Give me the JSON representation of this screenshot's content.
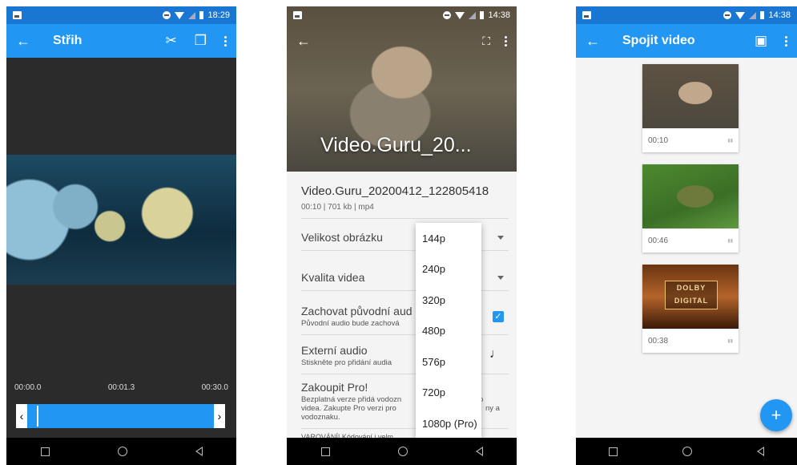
{
  "screen1": {
    "status_time": "18:29",
    "title": "Střih",
    "timeline": {
      "start": "00:00.0",
      "current": "00:01.3",
      "end": "00:30.0"
    },
    "handle_left": "‹",
    "handle_right": "›"
  },
  "screen2": {
    "status_time": "14:38",
    "video_overlay_title": "Video.Guru_20...",
    "file_name": "Video.Guru_20200412_122805418",
    "file_meta": "00:10 | 701 kb | mp4",
    "rows": {
      "image_size": "Velikost obrázku",
      "video_quality": "Kvalita videa",
      "keep_audio": "Zachovat původní aud",
      "keep_audio_sub": "Původní audio bude zachová",
      "external_audio": "Externí audio",
      "external_audio_sub": "Stiskněte pro přidání audia",
      "buy_pro": "Zakoupit Pro!",
      "buy_pro_sub1": "Bezplatná verze přidá vodozn",
      "buy_pro_sub1_tail": "o",
      "buy_pro_sub2": "videa. Zakupte Pro verzi pro",
      "buy_pro_sub2_tail": "ny a",
      "buy_pro_sub3": "vodoznaku.",
      "warning": "VAROVÁNÍ! Kódování i velm"
    },
    "dropdown_options": [
      "144p",
      "240p",
      "320p",
      "480p",
      "576p",
      "720p",
      "1080p (Pro)"
    ]
  },
  "screen3": {
    "status_time": "14:38",
    "title": "Spojit video",
    "clips": [
      {
        "duration": "00:10"
      },
      {
        "duration": "00:46"
      },
      {
        "duration": "00:38",
        "thumb_text_1": "DOLBY",
        "thumb_text_2": "DIGITAL"
      }
    ],
    "fab_label": "+"
  },
  "colors": {
    "accent": "#2196f3",
    "nav": "#000000"
  }
}
